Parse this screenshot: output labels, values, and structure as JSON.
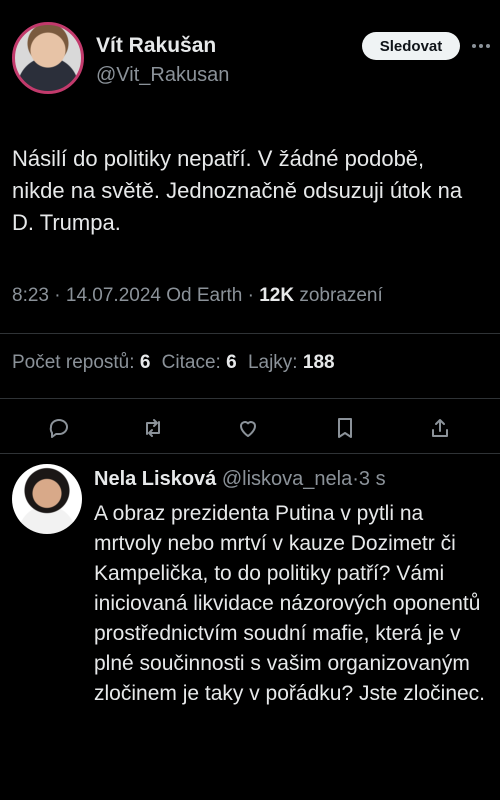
{
  "tweet": {
    "author_name": "Vít Rakušan",
    "author_handle": "@Vit_Rakusan",
    "follow_label": "Sledovat",
    "text": "Násilí do politiky nepatří. V žádné podobě, nikde na světě. Jednoznačně odsuzuji útok na D. Trumpa.",
    "time": "8:23",
    "date": "14.07.2024",
    "source": "Od Earth",
    "views_count": "12K",
    "views_label": "zobrazení",
    "separator": "·",
    "stats": {
      "reposts_label": "Počet repostů:",
      "reposts_value": "6",
      "quotes_label": "Citace:",
      "quotes_value": "6",
      "likes_label": "Lajky:",
      "likes_value": "188"
    },
    "actions": [
      "reply-icon",
      "repost-icon",
      "like-icon",
      "bookmark-icon",
      "share-icon"
    ]
  },
  "reply": {
    "author_name": "Nela Lisková",
    "author_handle": "@liskova_nela",
    "separator": "·",
    "time": "3 s",
    "text": "A obraz prezidenta Putina v pytli na mrtvoly nebo mrtví v kauze Dozimetr či Kampelička, to do politiky patří? Vámi iniciovaná likvidace názorových oponentů prostřednictvím soudní mafie, která je v plné součinnosti s vašim organizovaným zločinem je taky v pořádku? Jste zločinec."
  },
  "colors": {
    "background": "#000000",
    "text_primary": "#e7e9ea",
    "text_secondary": "#8b9299",
    "divider": "#2f3336",
    "avatar_ring": "#c23a6c"
  }
}
